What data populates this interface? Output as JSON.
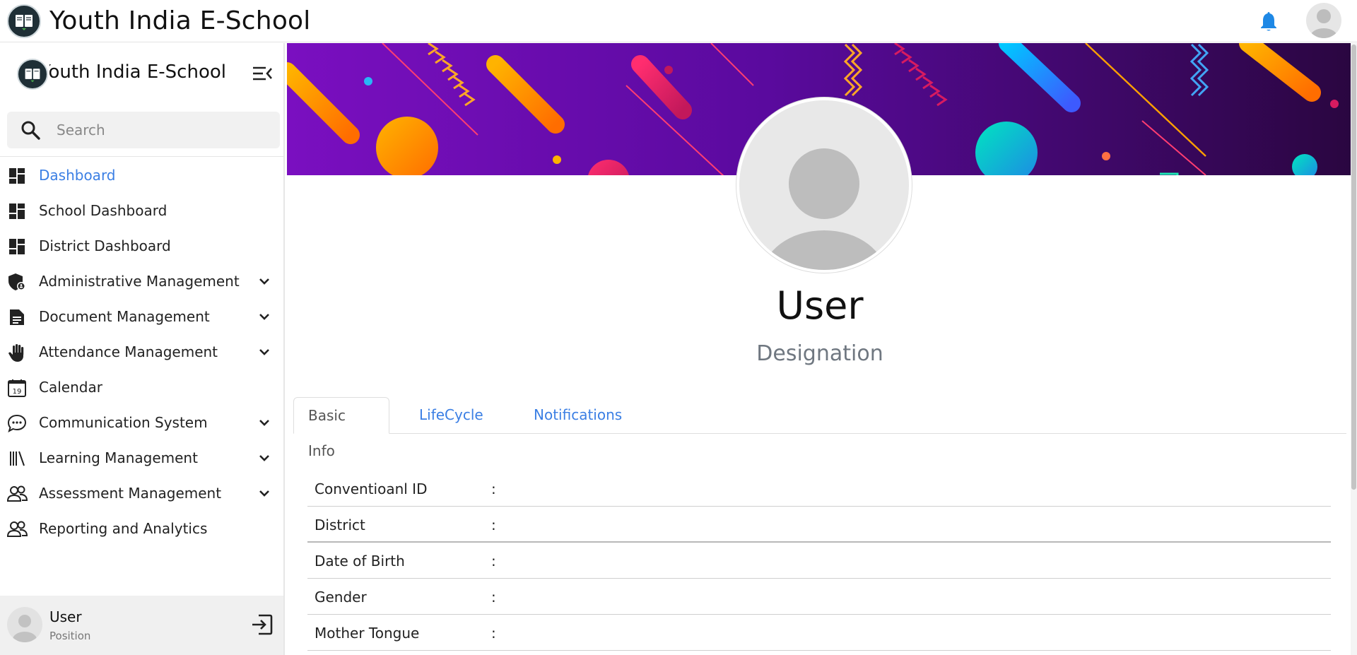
{
  "header": {
    "app_title": "Youth India E-School",
    "logo_icon": "book-logo-icon",
    "bell_icon": "bell-icon",
    "accent_color": "#1e88e5"
  },
  "sidebar": {
    "brand_text": "Youth India E-School",
    "search_placeholder": "Search",
    "items": [
      {
        "label": "Dashboard",
        "icon": "dashboard-icon",
        "active": true,
        "expandable": false
      },
      {
        "label": "School Dashboard",
        "icon": "dashboard-icon",
        "active": false,
        "expandable": false
      },
      {
        "label": "District Dashboard",
        "icon": "dashboard-icon",
        "active": false,
        "expandable": false
      },
      {
        "label": "Administrative Management",
        "icon": "admin-shield-icon",
        "active": false,
        "expandable": true
      },
      {
        "label": "Document Management",
        "icon": "document-icon",
        "active": false,
        "expandable": true
      },
      {
        "label": "Attendance Management",
        "icon": "hand-icon",
        "active": false,
        "expandable": true
      },
      {
        "label": "Calendar",
        "icon": "calendar-icon",
        "active": false,
        "expandable": false
      },
      {
        "label": "Communication System",
        "icon": "chat-icon",
        "active": false,
        "expandable": true
      },
      {
        "label": "Learning Management",
        "icon": "library-icon",
        "active": false,
        "expandable": true
      },
      {
        "label": "Assessment Management",
        "icon": "users-icon",
        "active": false,
        "expandable": true
      },
      {
        "label": "Reporting and Analytics",
        "icon": "users-icon",
        "active": false,
        "expandable": false
      }
    ],
    "calendar_day": "19",
    "footer": {
      "name": "User",
      "position": "Position"
    }
  },
  "profile": {
    "name": "User",
    "designation": "Designation"
  },
  "tabs": [
    {
      "label": "Basic Info",
      "active": true
    },
    {
      "label": "LifeCycle",
      "active": false
    },
    {
      "label": "Notifications",
      "active": false
    }
  ],
  "basic_info": [
    {
      "label": "Conventioanl ID",
      "value": ""
    },
    {
      "label": "District",
      "value": ""
    },
    {
      "label": "Date of Birth",
      "value": ""
    },
    {
      "label": "Gender",
      "value": ""
    },
    {
      "label": "Mother Tongue",
      "value": ""
    }
  ],
  "colors": {
    "active_link": "#3b7fe4",
    "banner_purple": "#6a0dad"
  }
}
